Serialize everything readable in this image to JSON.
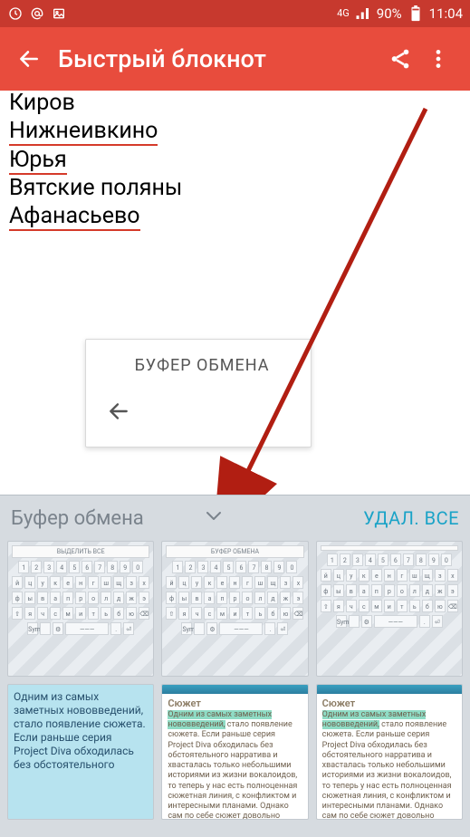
{
  "status": {
    "net_label": "4G",
    "battery_pct": "90%",
    "time": "11:04"
  },
  "appbar": {
    "title": "Быстрый блокнот"
  },
  "note": {
    "lines": [
      {
        "text": "Киров",
        "mark": false
      },
      {
        "text": "Нижнеивкино",
        "mark": true
      },
      {
        "text": "Юрья",
        "mark": true
      },
      {
        "text": "Вятские поляны",
        "mark": false
      },
      {
        "text": "Афанасьево",
        "mark": true
      }
    ]
  },
  "popup": {
    "title": "БУФЕР ОБМЕНА"
  },
  "clipboard": {
    "title": "Буфер обмена",
    "clear": "УДАЛ. ВСЕ",
    "items": [
      {
        "kind": "kb",
        "banner": "ВЫДЕЛИТЬ ВСЕ"
      },
      {
        "kind": "kb",
        "banner": "БУФЕР ОБМЕНА"
      },
      {
        "kind": "kb",
        "banner": ""
      },
      {
        "kind": "text",
        "text": "Одним из самых заметных нововведений, стало появление сюжета. Если раньше серия Project Diva обходилась без обстоятельного"
      },
      {
        "kind": "article",
        "heading": "Сюжет",
        "text": "Одним из самых заметных нововведений, стало появление сюжета. Если раньше серия Project Diva обходилась без обстоятельного нарратива и хвасталась только небольшими историями из жизни вокалоидов, то теперь у нас есть полноценная сюжетная линия, с конфликтом и интересными планами. Однако сам по себе сюжет довольно простой и предсказуемый, под фитнес-игры"
      },
      {
        "kind": "article",
        "heading": "Сюжет",
        "text": "Одним из самых заметных нововведений, стало появление сюжета. Если раньше серия Project Diva обходилась без обстоятельного нарратива и хвасталась только небольшими историями из жизни вокалоидов, то теперь у нас есть полноценная сюжетная линия, с конфликтом и интересными планами. Однако сам по себе сюжет довольно простой и предсказуемый, под фитнес-игры"
      }
    ]
  },
  "kb_rows": {
    "nums": [
      "1",
      "2",
      "3",
      "4",
      "5",
      "6",
      "7",
      "8",
      "9",
      "0"
    ],
    "r1": [
      "й",
      "ц",
      "у",
      "к",
      "е",
      "н",
      "г",
      "ш",
      "щ",
      "з",
      "х"
    ],
    "r2": [
      "ф",
      "ы",
      "в",
      "а",
      "п",
      "р",
      "о",
      "л",
      "д",
      "ж",
      "э"
    ],
    "r3": [
      "⇧",
      "я",
      "ч",
      "с",
      "м",
      "и",
      "т",
      "ь",
      "б",
      "ю",
      "⌫"
    ]
  }
}
